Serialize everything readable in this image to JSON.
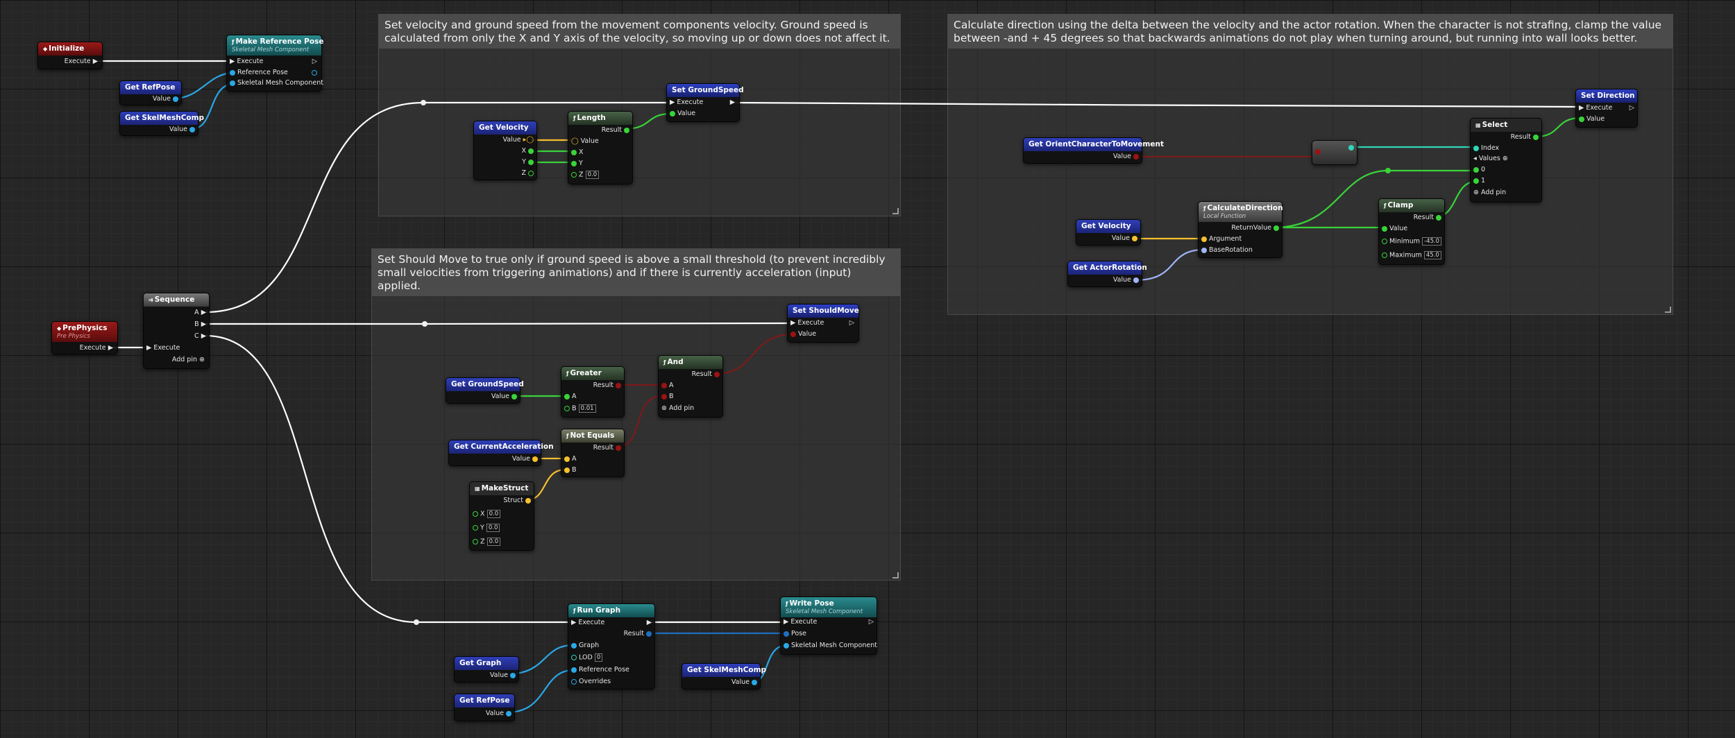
{
  "comments": {
    "velocity": "Set velocity and ground speed from the movement components velocity. Ground speed is calculated from only the X and Y axis of the velocity, so moving up or down does not affect it.",
    "should_move": "Set Should Move to true only if ground speed is above a small threshold (to prevent incredibly small velocities from triggering animations) and if there is currently acceleration (input) applied.",
    "direction": "Calculate direction using the delta between the velocity and the actor rotation. When the character is not strafing, clamp the value between -and + 45 degrees so that backwards animations do not play when turning around, but running into wall looks better."
  },
  "nodes": {
    "initialize": {
      "title": "Initialize",
      "execute": "Execute"
    },
    "make_ref_pose": {
      "title": "Make Reference Pose",
      "subtitle": "Skeletal Mesh Component",
      "execute": "Execute",
      "pin_ref": "Reference Pose",
      "pin_skel": "Skeletal Mesh Component"
    },
    "get_refpose_1": {
      "title": "Get RefPose",
      "value": "Value"
    },
    "get_skelmesh_1": {
      "title": "Get SkelMeshComp",
      "value": "Value"
    },
    "prephysics": {
      "title": "PrePhysics",
      "subtitle": "Pre Physics",
      "execute": "Execute"
    },
    "sequence": {
      "title": "Sequence",
      "pin_a": "A",
      "pin_b": "B",
      "pin_c": "C",
      "execute": "Execute",
      "add_pin": "Add pin"
    },
    "get_velocity_1": {
      "title": "Get Velocity",
      "value": "Value",
      "x": "X",
      "y": "Y",
      "z": "Z"
    },
    "length": {
      "title": "Length",
      "result": "Result",
      "value": "Value",
      "x": "X",
      "y": "Y",
      "z": "Z",
      "z_default": "0.0"
    },
    "set_groundspeed": {
      "title": "Set GroundSpeed",
      "execute": "Execute",
      "value": "Value"
    },
    "set_shouldmove": {
      "title": "Set ShouldMove",
      "execute": "Execute",
      "value": "Value"
    },
    "get_groundspeed": {
      "title": "Get GroundSpeed",
      "value": "Value"
    },
    "greater": {
      "title": "Greater",
      "result": "Result",
      "a": "A",
      "b": "B",
      "b_default": "0.01"
    },
    "and": {
      "title": "And",
      "result": "Result",
      "a": "A",
      "b": "B",
      "add_pin": "Add pin"
    },
    "get_accel": {
      "title": "Get CurrentAcceleration",
      "value": "Value"
    },
    "not_equals": {
      "title": "Not Equals",
      "result": "Result",
      "a": "A",
      "b": "B"
    },
    "make_struct": {
      "title": "MakeStruct",
      "struct": "Struct",
      "x": "X",
      "y": "Y",
      "z": "Z",
      "x_default": "0.0",
      "y_default": "0.0",
      "z_default": "0.0"
    },
    "get_orient": {
      "title": "Get OrientCharacterToMovement",
      "value": "Value"
    },
    "get_velocity_2": {
      "title": "Get Velocity",
      "value": "Value"
    },
    "get_actor_rot": {
      "title": "Get ActorRotation",
      "value": "Value"
    },
    "calc_dir": {
      "title": "CalculateDirection",
      "subtitle": "Local Function",
      "return": "ReturnValue",
      "argument": "Argument",
      "base_rot": "BaseRotation"
    },
    "clamp": {
      "title": "Clamp",
      "result": "Result",
      "value": "Value",
      "minimum": "Minimum",
      "maximum": "Maximum",
      "min_default": "-45.0",
      "max_default": "45.0"
    },
    "select": {
      "title": "Select",
      "result": "Result",
      "index": "Index",
      "values": "Values",
      "v0": "0",
      "v1": "1",
      "add_pin": "Add pin"
    },
    "set_direction": {
      "title": "Set Direction",
      "execute": "Execute",
      "value": "Value"
    },
    "run_graph": {
      "title": "Run Graph",
      "execute": "Execute",
      "result": "Result",
      "graph": "Graph",
      "lod": "LOD",
      "lod_default": "0",
      "ref_pose": "Reference Pose",
      "overrides": "Overrides"
    },
    "get_graph": {
      "title": "Get Graph",
      "value": "Value"
    },
    "get_refpose_2": {
      "title": "Get RefPose",
      "value": "Value"
    },
    "write_pose": {
      "title": "Write Pose",
      "subtitle": "Skeletal Mesh Component",
      "execute": "Execute",
      "pose": "Pose",
      "skel": "Skeletal Mesh Component"
    },
    "get_skelmesh_2": {
      "title": "Get SkelMeshComp",
      "value": "Value"
    }
  },
  "colors": {
    "exec": "#ffffff",
    "float": "#39d43a",
    "vector": "#f6c02e",
    "rotator": "#9fb5f5",
    "bool": "#9b1313",
    "object": "#2aa8e8",
    "int": "#2ed6b9",
    "select_wire": "#3fd1a8"
  }
}
